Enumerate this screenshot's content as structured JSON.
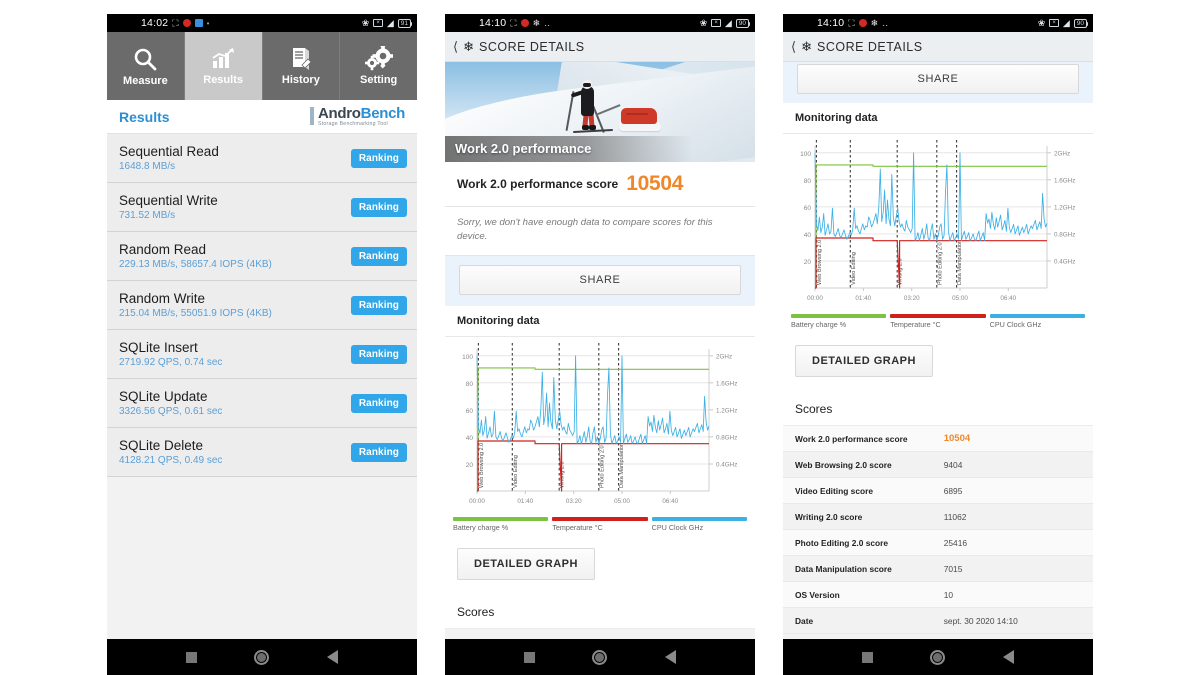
{
  "panel1": {
    "statusbar": {
      "time": "14:02",
      "battery": "91"
    },
    "tabs": [
      {
        "label": "Measure",
        "icon": "search-icon",
        "active": false
      },
      {
        "label": "Results",
        "icon": "bar-chart-icon",
        "active": true
      },
      {
        "label": "History",
        "icon": "document-pen-icon",
        "active": false
      },
      {
        "label": "Setting",
        "icon": "gears-icon",
        "active": false
      }
    ],
    "title": "Results",
    "logo": {
      "part1": "Andro",
      "part2": "Bench",
      "tagline": "Storage Benchmarking Tool"
    },
    "rows": [
      {
        "label": "Sequential Read",
        "value": "1648.8 MB/s",
        "button": "Ranking"
      },
      {
        "label": "Sequential Write",
        "value": "731.52 MB/s",
        "button": "Ranking"
      },
      {
        "label": "Random Read",
        "value": "229.13 MB/s, 58657.4 IOPS (4KB)",
        "button": "Ranking"
      },
      {
        "label": "Random Write",
        "value": "215.04 MB/s, 55051.9 IOPS (4KB)",
        "button": "Ranking"
      },
      {
        "label": "SQLite Insert",
        "value": "2719.92 QPS, 0.74 sec",
        "button": "Ranking"
      },
      {
        "label": "SQLite Update",
        "value": "3326.56 QPS, 0.61 sec",
        "button": "Ranking"
      },
      {
        "label": "SQLite Delete",
        "value": "4128.21 QPS, 0.49 sec",
        "button": "Ranking"
      }
    ]
  },
  "panel2": {
    "statusbar": {
      "time": "14:10",
      "battery": "90"
    },
    "appbar_title": "SCORE DETAILS",
    "hero_caption": "Work 2.0 performance",
    "score_label": "Work 2.0 performance score",
    "score_value": "10504",
    "note": "Sorry, we don't have enough data to compare scores for this device.",
    "share_label": "SHARE",
    "monitoring_label": "Monitoring data",
    "detailed_graph_label": "DETAILED GRAPH",
    "scores_label": "Scores"
  },
  "panel3": {
    "statusbar": {
      "time": "14:10",
      "battery": "90"
    },
    "appbar_title": "SCORE DETAILS",
    "share_label": "SHARE",
    "monitoring_label": "Monitoring data",
    "detailed_graph_label": "DETAILED GRAPH",
    "scores_label": "Scores",
    "table": [
      {
        "key": "Work 2.0 performance score",
        "value": "10504",
        "highlight": true
      },
      {
        "key": "Web Browsing 2.0 score",
        "value": "9404",
        "highlight": false
      },
      {
        "key": "Video Editing score",
        "value": "6895",
        "highlight": false
      },
      {
        "key": "Writing 2.0 score",
        "value": "11062",
        "highlight": false
      },
      {
        "key": "Photo Editing 2.0 score",
        "value": "25416",
        "highlight": false
      },
      {
        "key": "Data Manipulation score",
        "value": "7015",
        "highlight": false
      },
      {
        "key": "OS Version",
        "value": "10",
        "highlight": false
      },
      {
        "key": "Date",
        "value": "sept. 30 2020 14:10",
        "highlight": false
      }
    ]
  },
  "colors": {
    "battery": "#7cc242",
    "temperature": "#d0201c",
    "cpu": "#3cb0e5",
    "accent_orange": "#f0872a",
    "accent_blue": "#2a8fd4",
    "ranking_blue": "#31a6e8"
  },
  "chart_data": {
    "type": "line",
    "title": "Monitoring data",
    "xlabel": "",
    "ylabel": "",
    "grid": true,
    "legend_position": "bottom",
    "xlim": [
      0,
      480
    ],
    "x_tick_labels": [
      "00:00",
      "01:40",
      "03:20",
      "05:00",
      "06:40"
    ],
    "x_tick_values": [
      0,
      100,
      200,
      300,
      400
    ],
    "left_axis": {
      "label": "%",
      "ylim": [
        0,
        105
      ],
      "tick_labels": [
        "20",
        "40",
        "60",
        "80",
        "100"
      ],
      "tick_values": [
        20,
        40,
        60,
        80,
        100
      ]
    },
    "right_axis": {
      "label": "GHz",
      "ylim": [
        0,
        2.1
      ],
      "tick_labels": [
        "0.4GHz",
        "0.8GHz",
        "1.2GHz",
        "1.6GHz",
        "2GHz"
      ],
      "tick_values": [
        0.4,
        0.8,
        1.2,
        1.6,
        2.0
      ]
    },
    "annotations": [
      {
        "label": "Web Browsing 2.0",
        "x": 3
      },
      {
        "label": "Video Editing",
        "x": 73
      },
      {
        "label": "Writing 2.0",
        "x": 170
      },
      {
        "label": "Photo Editing 2.0",
        "x": 252
      },
      {
        "label": "Data Manipulation",
        "x": 293
      }
    ],
    "series": [
      {
        "name": "Battery charge %",
        "color": "#7cc242",
        "unit": "%",
        "axis": "left",
        "x": [
          0,
          2,
          2,
          120,
          120,
          480
        ],
        "values": [
          0,
          0,
          91,
          91,
          90,
          90
        ]
      },
      {
        "name": "Temperature °C",
        "color": "#d0201c",
        "unit": "°C",
        "axis": "left",
        "x": [
          0,
          2,
          2,
          120,
          120,
          170,
          170,
          175,
          175,
          480
        ],
        "values": [
          0,
          0,
          37,
          37,
          35,
          35,
          35,
          0,
          35,
          35
        ]
      },
      {
        "name": "CPU Clock GHz",
        "color": "#3cb0e5",
        "unit": "GHz",
        "axis": "right",
        "x": [
          0,
          3,
          6,
          9,
          12,
          15,
          18,
          21,
          24,
          27,
          30,
          33,
          36,
          39,
          42,
          45,
          48,
          51,
          54,
          57,
          60,
          63,
          66,
          69,
          72,
          75,
          78,
          81,
          84,
          87,
          90,
          93,
          96,
          99,
          102,
          105,
          108,
          111,
          114,
          117,
          120,
          123,
          126,
          129,
          132,
          135,
          138,
          141,
          144,
          147,
          150,
          153,
          156,
          159,
          162,
          165,
          168,
          171,
          174,
          177,
          180,
          183,
          186,
          189,
          192,
          195,
          198,
          201,
          204,
          207,
          210,
          213,
          216,
          219,
          222,
          225,
          228,
          231,
          234,
          237,
          240,
          243,
          246,
          249,
          252,
          255,
          258,
          261,
          264,
          267,
          270,
          273,
          276,
          279,
          282,
          285,
          288,
          291,
          294,
          297,
          300,
          303,
          306,
          309,
          312,
          315,
          318,
          321,
          324,
          327,
          330,
          333,
          336,
          339,
          342,
          345,
          348,
          351,
          354,
          357,
          360,
          363,
          366,
          369,
          372,
          375,
          378,
          381,
          384,
          387,
          390,
          393,
          396,
          399,
          402,
          405,
          408,
          411,
          414,
          417,
          420,
          423,
          426,
          429,
          432,
          435,
          438,
          441,
          444,
          447,
          450,
          453,
          456,
          459,
          462,
          465,
          468,
          471,
          474,
          477,
          480
        ],
        "values": [
          2.0,
          0.95,
          0.85,
          1.05,
          0.82,
          0.9,
          1.1,
          0.78,
          0.86,
          0.95,
          0.8,
          0.84,
          1.18,
          0.8,
          0.76,
          0.82,
          0.88,
          0.78,
          0.74,
          0.8,
          0.86,
          0.78,
          0.72,
          0.76,
          0.82,
          0.78,
          0.86,
          1.18,
          0.88,
          0.92,
          0.84,
          0.8,
          0.88,
          0.95,
          0.86,
          0.92,
          0.9,
          1.05,
          1.0,
          0.9,
          0.95,
          1.02,
          1.1,
          0.95,
          1.2,
          1.76,
          0.98,
          1.12,
          1.45,
          0.95,
          1.3,
          1.02,
          0.92,
          1.68,
          1.05,
          0.92,
          1.05,
          1.18,
          0.98,
          0.9,
          0.95,
          0.88,
          0.84,
          1.0,
          0.9,
          0.86,
          0.82,
          0.88,
          2.0,
          0.7,
          0.74,
          0.82,
          0.7,
          0.78,
          0.88,
          0.72,
          0.8,
          0.95,
          0.74,
          0.7,
          0.86,
          0.95,
          0.72,
          0.8,
          0.7,
          0.78,
          0.9,
          0.95,
          0.72,
          0.78,
          1.42,
          1.82,
          0.84,
          0.7,
          0.76,
          0.82,
          0.7,
          0.74,
          0.8,
          0.72,
          2.0,
          0.7,
          0.78,
          0.84,
          0.72,
          0.76,
          0.82,
          0.7,
          0.74,
          0.8,
          0.72,
          0.7,
          0.78,
          0.84,
          0.7,
          0.76,
          0.82,
          0.7,
          1.1,
          0.96,
          1.02,
          0.88,
          1.12,
          0.94,
          0.86,
          1.04,
          0.9,
          0.98,
          1.08,
          0.86,
          0.92,
          1.0,
          0.84,
          1.18,
          0.9,
          0.82,
          0.88,
          0.94,
          0.8,
          0.86,
          0.92,
          0.78,
          0.84,
          0.9,
          0.82,
          0.88,
          0.94,
          0.8,
          0.86,
          0.92,
          0.88,
          0.94,
          1.0,
          0.86,
          0.92,
          0.98,
          0.88,
          1.4,
          1.02,
          0.9,
          0.96,
          0.88,
          1.0,
          0.92,
          0.98
        ]
      }
    ]
  }
}
